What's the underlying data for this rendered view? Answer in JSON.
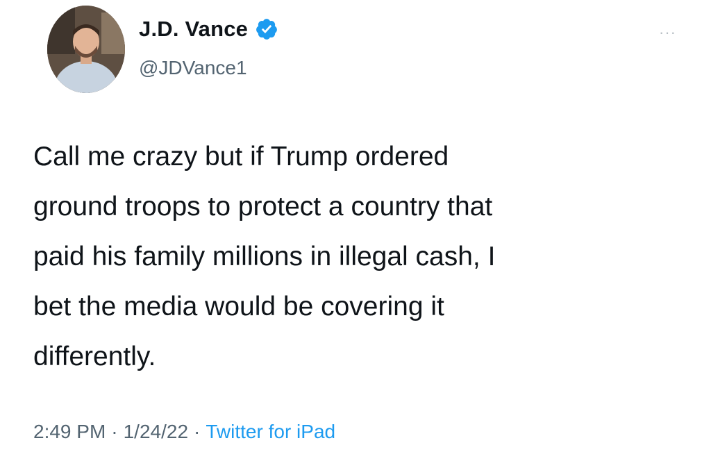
{
  "author": {
    "display_name": "J.D. Vance",
    "handle": "@JDVance1",
    "verified": true
  },
  "more_label": "···",
  "tweet": {
    "text": "Call me crazy but if Trump ordered\nground troops to protect a country that\npaid his family millions in illegal cash, I\nbet the media would be covering it\ndifferently."
  },
  "meta": {
    "time": "2:49 PM",
    "separator": "·",
    "date": "1/24/22",
    "source": "Twitter for iPad"
  },
  "colors": {
    "verified_badge": "#1d9bf0",
    "source_link": "#1d9bf0",
    "secondary_text": "#536471"
  }
}
